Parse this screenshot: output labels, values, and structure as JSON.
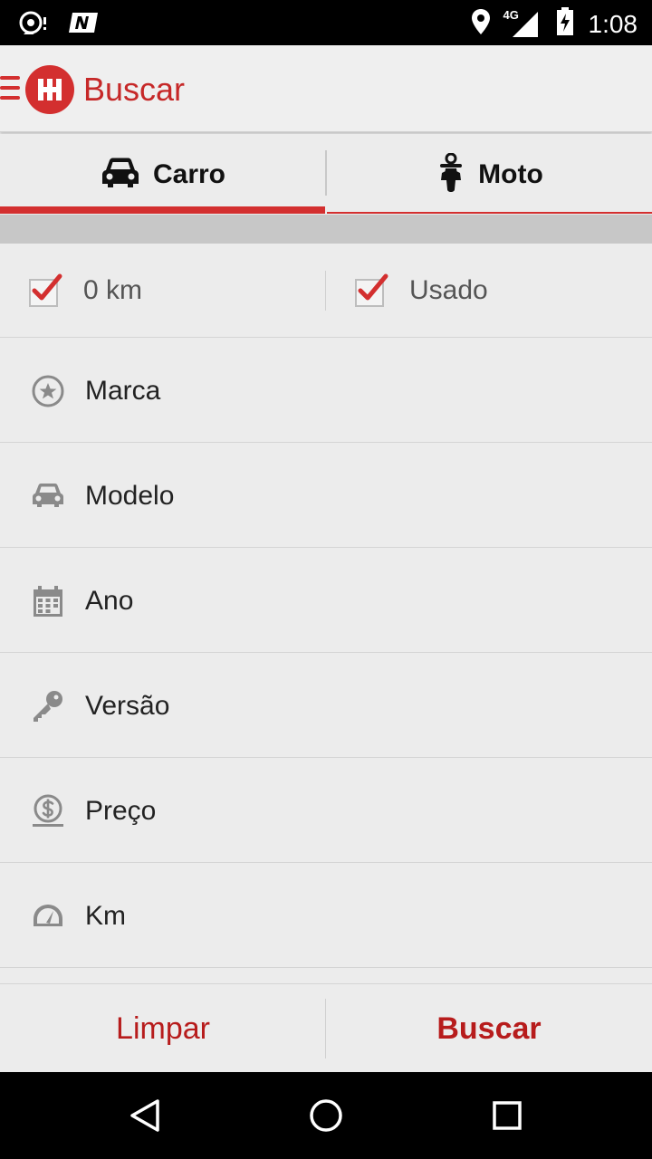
{
  "status_bar": {
    "time": "1:08",
    "network": "4G",
    "icons": [
      "podcast-icon",
      "n-app-icon",
      "location-icon",
      "signal-4g-icon",
      "battery-charging-icon"
    ]
  },
  "app_bar": {
    "title": "Buscar",
    "accent_color": "#d32f2f"
  },
  "tabs": [
    {
      "label": "Carro",
      "icon": "car-icon",
      "selected": true
    },
    {
      "label": "Moto",
      "icon": "motorcycle-rider-icon",
      "selected": false
    }
  ],
  "condition_filters": [
    {
      "label": "0 km",
      "checked": true
    },
    {
      "label": "Usado",
      "checked": true
    }
  ],
  "filters": [
    {
      "label": "Marca",
      "icon": "star-circle-icon"
    },
    {
      "label": "Modelo",
      "icon": "car-icon"
    },
    {
      "label": "Ano",
      "icon": "calendar-icon"
    },
    {
      "label": "Versão",
      "icon": "key-icon"
    },
    {
      "label": "Preço",
      "icon": "money-icon"
    },
    {
      "label": "Km",
      "icon": "speedometer-icon"
    }
  ],
  "actions": {
    "clear_label": "Limpar",
    "search_label": "Buscar"
  },
  "nav_bar": {
    "icons": [
      "back-icon",
      "home-icon",
      "recent-apps-icon"
    ]
  }
}
